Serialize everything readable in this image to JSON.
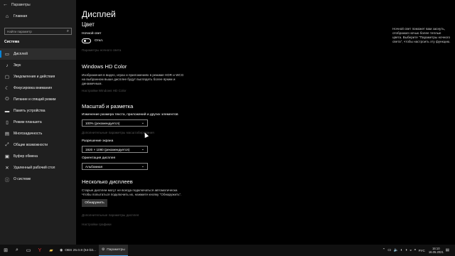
{
  "window": {
    "title": "Параметры",
    "back_icon": "←"
  },
  "sidebar": {
    "home_label": "Главная",
    "search_placeholder": "Найти параметр",
    "section_title": "Система",
    "items": [
      {
        "label": "Дисплей",
        "icon": "▭",
        "active": true
      },
      {
        "label": "Звук",
        "icon": "♪"
      },
      {
        "label": "Уведомления и действия",
        "icon": "▢"
      },
      {
        "label": "Фокусировка внимания",
        "icon": "☾"
      },
      {
        "label": "Питание и спящий режим",
        "icon": "⏻"
      },
      {
        "label": "Память устройства",
        "icon": "▬"
      },
      {
        "label": "Режим планшета",
        "icon": "▯"
      },
      {
        "label": "Многозадачность",
        "icon": "▤"
      },
      {
        "label": "Общие возможности",
        "icon": "⤢"
      },
      {
        "label": "Буфер обмена",
        "icon": "▣"
      },
      {
        "label": "Удаленный рабочий стол",
        "icon": "✕"
      },
      {
        "label": "О системе",
        "icon": "ⓘ"
      }
    ]
  },
  "main": {
    "page_title": "Дисплей",
    "color": {
      "title": "Цвет",
      "night_light_label": "Ночной свет",
      "toggle_state": "Откл.",
      "night_light_settings_link": "Параметры ночного света"
    },
    "hd_color": {
      "title": "Windows HD Color",
      "description": "Изображения в видео, играх и приложениях в режиме HDR и WCG на выбранном выше дисплее будут выглядеть более ярким и динамичным.",
      "settings_link": "Настройки Windows HD Color"
    },
    "scale": {
      "title": "Масштаб и разметка",
      "size_label": "Изменение размера текста, приложений и других элементов",
      "size_value": "100% (рекомендуется)",
      "advanced_link": "Дополнительные параметры масштабирования",
      "resolution_label": "Разрешение экрана",
      "resolution_value": "1920 × 1080 (рекомендуется)",
      "orientation_label": "Ориентация дисплея",
      "orientation_value": "Альбомная"
    },
    "multi": {
      "title": "Несколько дисплеев",
      "description": "Старые дисплеи могут не всегда подключаться автоматически. Чтобы попытаться подключить их, нажмите кнопку \"Обнаружить\".",
      "detect_button": "Обнаружить",
      "advanced_link": "Дополнительные параметры дисплея",
      "graphics_link": "Настройки графики"
    },
    "side_note": "Ночной свет поможет вам заснуть, отображая ночью более теплые цвета. Выберите \"Параметры ночного света\", чтобы настроить эту функцию."
  },
  "taskbar": {
    "task_label": "OBS 25.0.8 (64-bit...",
    "active_app_label": "Параметры",
    "lang": "РУС",
    "time": "16:10",
    "date": "16.05.2021"
  }
}
